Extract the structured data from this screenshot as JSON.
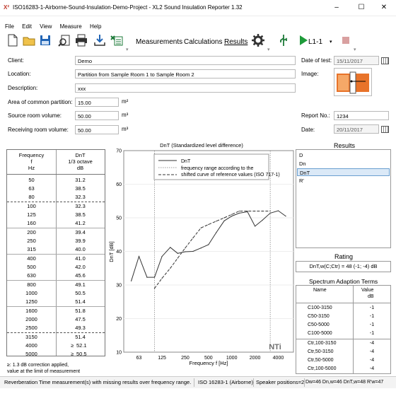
{
  "window": {
    "title": "ISO16283-1-Airborne-Sound-Insulation-Demo-Project - XL2 Sound Insulation Reporter 1.32",
    "minimize": "–",
    "maximize": "☐",
    "close": "✕"
  },
  "menu": [
    "File",
    "Edit",
    "View",
    "Measure",
    "Help"
  ],
  "toolbar": {
    "measurements": "Measurements",
    "calculations": "Calculations",
    "results": "Results",
    "position": "L1-1"
  },
  "form": {
    "client_label": "Client:",
    "client_value": "Demo",
    "location_label": "Location:",
    "location_value": "Partition from Sample Room 1 to Sample Room 2",
    "description_label": "Description:",
    "description_value": "xxx",
    "area_label": "Area of common partition:",
    "area_value": "15.00",
    "area_unit": "m²",
    "source_label": "Source room volume:",
    "source_value": "50.00",
    "source_unit": "m³",
    "receiving_label": "Receiving room volume:",
    "receiving_value": "50.00",
    "receiving_unit": "m³",
    "date_test_label": "Date of test:",
    "date_test_value": "15/11/2017",
    "image_label": "Image:",
    "report_label": "Report No.:",
    "report_value": "1234",
    "date_label": "Date:",
    "date_value": "20/11/2017"
  },
  "table": {
    "col1_l1": "Frequency",
    "col1_l2": "f",
    "col1_l3": "Hz",
    "col2_l1": "DnT",
    "col2_l2": "1/3 octave",
    "col2_l3": "dB",
    "rows": [
      {
        "f": "50",
        "v": "31.2"
      },
      {
        "f": "63",
        "v": "38.5"
      },
      {
        "f": "80",
        "v": "32.3"
      },
      {
        "f": "100",
        "v": "32.3"
      },
      {
        "f": "125",
        "v": "38.5"
      },
      {
        "f": "160",
        "v": "41.2"
      },
      {
        "f": "200",
        "v": "39.4"
      },
      {
        "f": "250",
        "v": "39.9"
      },
      {
        "f": "315",
        "v": "40.0"
      },
      {
        "f": "400",
        "v": "41.0"
      },
      {
        "f": "500",
        "v": "42.0"
      },
      {
        "f": "630",
        "v": "45.6"
      },
      {
        "f": "800",
        "v": "49.1"
      },
      {
        "f": "1000",
        "v": "50.5"
      },
      {
        "f": "1250",
        "v": "51.4"
      },
      {
        "f": "1600",
        "v": "51.8"
      },
      {
        "f": "2000",
        "v": "47.5"
      },
      {
        "f": "2500",
        "v": "49.3"
      },
      {
        "f": "3150",
        "v": "51.4"
      },
      {
        "f": "4000",
        "v": "52.1",
        "ge": "≥"
      },
      {
        "f": "5000",
        "v": "50.5",
        "ge": "≥"
      }
    ],
    "footnote1": "≥: 1.3 dB correction applied,",
    "footnote2": "value at the limit of measurement"
  },
  "chart_data": {
    "type": "line",
    "title": "DnT (Standardized level difference)",
    "xlabel": "Frequency f [Hz]",
    "ylabel": "DnT [dB]",
    "ylim": [
      10,
      70
    ],
    "yticks": [
      "10",
      "20",
      "30",
      "40",
      "50",
      "60",
      "70"
    ],
    "xticks": [
      "63",
      "125",
      "250",
      "500",
      "1000",
      "2000",
      "4000"
    ],
    "x": [
      50,
      63,
      80,
      100,
      125,
      160,
      200,
      250,
      315,
      400,
      500,
      630,
      800,
      1000,
      1250,
      1600,
      2000,
      2500,
      3150,
      4000,
      5000
    ],
    "series": [
      {
        "name": "DnT",
        "style": "solid",
        "values": [
          31.2,
          38.5,
          32.3,
          32.3,
          38.5,
          41.2,
          39.4,
          39.9,
          40.0,
          41.0,
          42.0,
          45.6,
          49.1,
          50.5,
          51.4,
          51.8,
          47.5,
          49.3,
          51.4,
          52.1,
          50.5
        ]
      },
      {
        "name": "shifted curve of reference values (ISO 717-1)",
        "style": "dashed",
        "x": [
          100,
          125,
          160,
          200,
          250,
          315,
          400,
          500,
          630,
          800,
          1000,
          1250,
          1600,
          2000,
          2500,
          3150
        ],
        "values": [
          29,
          32,
          35,
          38,
          41,
          44,
          47,
          48,
          49,
          50,
          51,
          52,
          52,
          52,
          52,
          52
        ]
      }
    ],
    "range_lines_hz": [
      100,
      3150
    ],
    "legend": [
      "DnT",
      "frequency range according to the",
      "shifted curve of reference values (ISO 717-1)"
    ],
    "legend_position": "top-center",
    "watermark": "NTi"
  },
  "results": {
    "heading": "Results",
    "items": [
      "D",
      "Dn",
      "DnT",
      "R'"
    ],
    "selected": 2
  },
  "rating": {
    "heading": "Rating",
    "value": "DnT,w(C;Ctr) = 48 (-1; -4) dB"
  },
  "spectrum": {
    "heading": "Spectrum Adaption Terms",
    "col_name": "Name",
    "col_value": "Value",
    "col_unit": "dB",
    "rows": [
      {
        "n": "C100-3150",
        "v": "-1"
      },
      {
        "n": "C50-3150",
        "v": "-1"
      },
      {
        "n": "C50-5000",
        "v": "-1"
      },
      {
        "n": "C100-5000",
        "v": "-1"
      },
      {
        "n": "Ctr,100-3150",
        "v": "-4"
      },
      {
        "n": "Ctr,50-3150",
        "v": "-4"
      },
      {
        "n": "Ctr,50-5000",
        "v": "-4"
      },
      {
        "n": "Ctr,100-5000",
        "v": "-4"
      }
    ]
  },
  "status": {
    "message": "Reverberation Time measurement(s) with missing results over frequency range.",
    "standard": "ISO 16283-1 (Airborne)",
    "speaker": "Speaker positions=2",
    "values": "Dw=46  Dn,w=46  DnT,w=48  R'w=47"
  }
}
